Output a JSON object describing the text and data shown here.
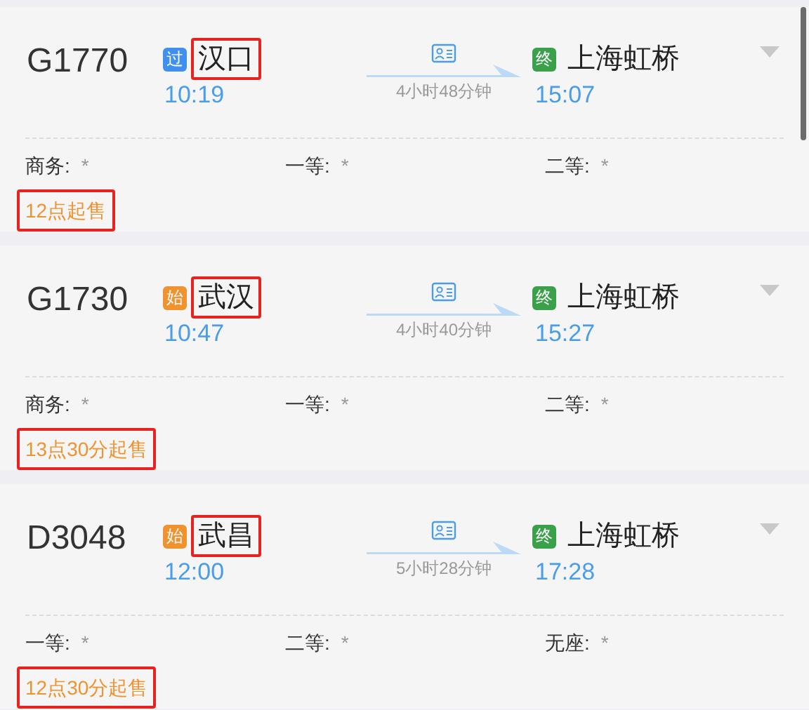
{
  "trains": [
    {
      "number": "G1770",
      "from": {
        "badge": "过",
        "kind": "pass",
        "name": "汉口",
        "highlighted": true,
        "time": "10:19"
      },
      "duration": "4小时48分钟",
      "to": {
        "badge": "终",
        "kind": "end",
        "name": "上海虹桥",
        "time": "15:07"
      },
      "seats": [
        {
          "label": "商务:",
          "value": "*"
        },
        {
          "label": "一等:",
          "value": "*"
        },
        {
          "label": "二等:",
          "value": "*"
        }
      ],
      "sale": {
        "text": "12点起售",
        "highlighted": true
      }
    },
    {
      "number": "G1730",
      "from": {
        "badge": "始",
        "kind": "start",
        "name": "武汉",
        "highlighted": true,
        "time": "10:47"
      },
      "duration": "4小时40分钟",
      "to": {
        "badge": "终",
        "kind": "end",
        "name": "上海虹桥",
        "time": "15:27"
      },
      "seats": [
        {
          "label": "商务:",
          "value": "*"
        },
        {
          "label": "一等:",
          "value": "*"
        },
        {
          "label": "二等:",
          "value": "*"
        }
      ],
      "sale": {
        "text": "13点30分起售",
        "highlighted": true
      }
    },
    {
      "number": "D3048",
      "from": {
        "badge": "始",
        "kind": "start",
        "name": "武昌",
        "highlighted": true,
        "time": "12:00"
      },
      "duration": "5小时28分钟",
      "to": {
        "badge": "终",
        "kind": "end",
        "name": "上海虹桥",
        "time": "17:28"
      },
      "seats": [
        {
          "label": "一等:",
          "value": "*"
        },
        {
          "label": "二等:",
          "value": "*"
        },
        {
          "label": "无座:",
          "value": "*"
        }
      ],
      "sale": {
        "text": "12点30分起售",
        "highlighted": true
      }
    }
  ]
}
